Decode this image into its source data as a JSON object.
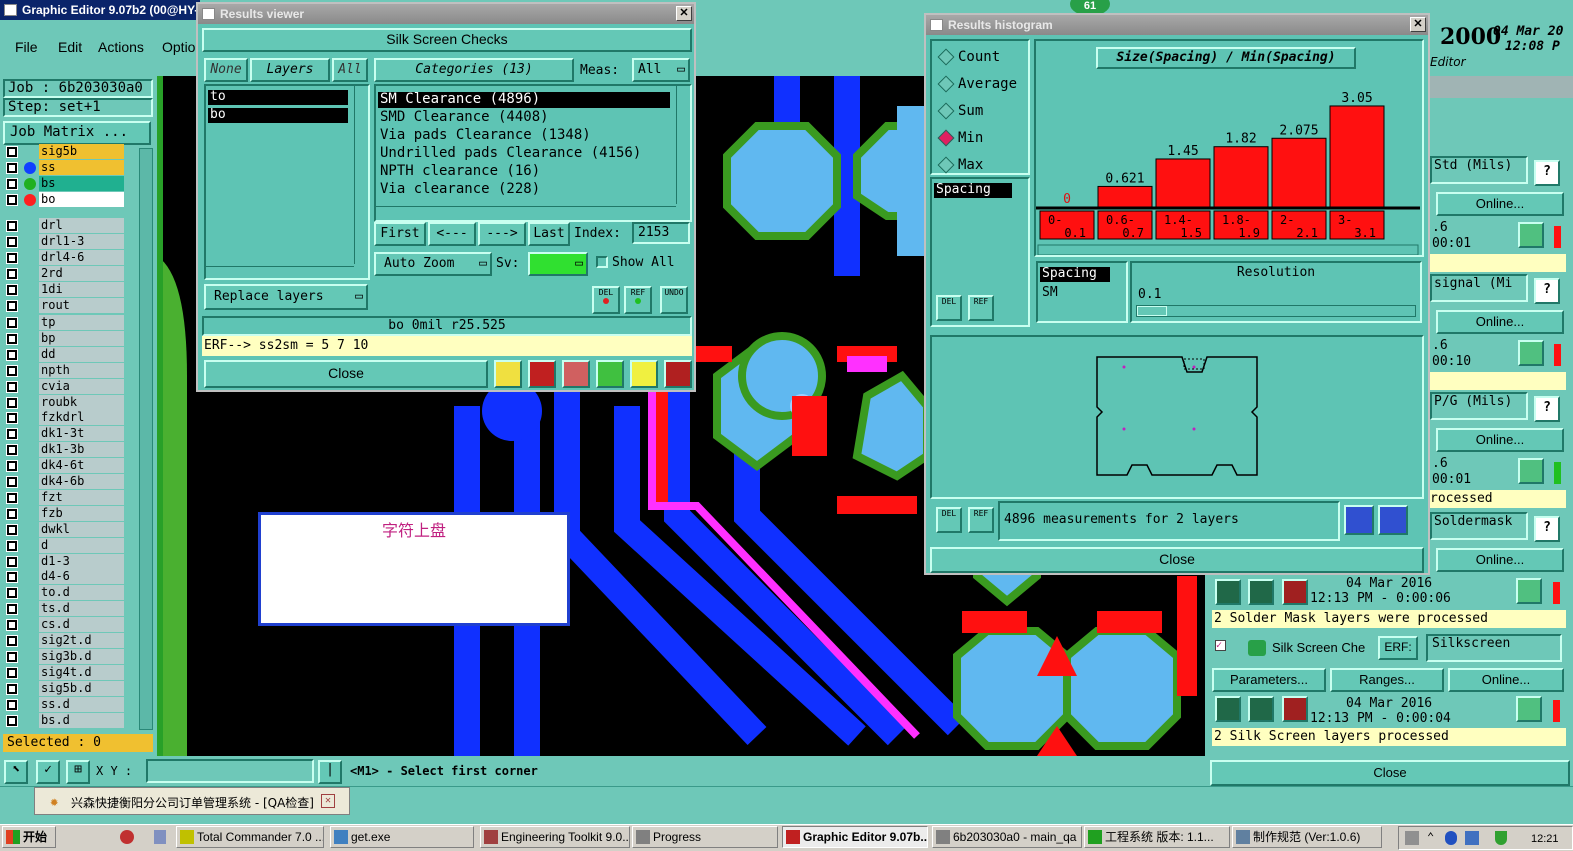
{
  "main": {
    "title": "Graphic Editor 9.07b2 (00@HY-I",
    "menu": [
      "File",
      "Edit",
      "Actions",
      "Optio"
    ],
    "job": "Job : 6b203030a0",
    "step": "Step: set+1",
    "job_matrix": "Job Matrix ...",
    "selected": "Selected : 0",
    "layers_top": [
      {
        "name": "sig5b",
        "color": "#f0c030"
      },
      {
        "name": "ss",
        "color": "#f0c030",
        "dot": "#1040ff"
      },
      {
        "name": "bs",
        "color": "#20b090",
        "dot": "#20b020"
      },
      {
        "name": "bo",
        "color": "#ffffff",
        "dot": "#ff2020"
      }
    ],
    "layers_mid": [
      "drl",
      "drl1-3",
      "drl4-6",
      "2rd",
      "1di",
      "rout"
    ],
    "layers_bottom": [
      "tp",
      "bp",
      "dd",
      "npth",
      "cvia",
      "roubk",
      "fzkdrl",
      "dk1-3t",
      "dk1-3b",
      "dk4-6t",
      "dk4-6b",
      "fzt",
      "fzb",
      "dwkl",
      "d",
      "d1-3",
      "d4-6",
      "to.d",
      "ts.d",
      "cs.d",
      "sig2t.d",
      "sig3b.d",
      "sig4t.d",
      "sig5b.d",
      "ss.d",
      "bs.d"
    ],
    "coord_label": "X Y :",
    "status_msg": "<M1> - Select first corner",
    "date_right": "04 Mar 20",
    "time_right": "12:08 P",
    "year": "2000",
    "editor_label": "Editor",
    "badge_61": "61"
  },
  "annotation_box": {
    "text": "字符上盘"
  },
  "results_viewer": {
    "title": "Results viewer",
    "header": "Silk Screen Checks",
    "none": "None",
    "layers": "Layers",
    "all": "All",
    "categories": "Categories (13)",
    "meas_label": "Meas:",
    "meas_value": "All",
    "layer_items": [
      "to",
      "bo"
    ],
    "category_items": [
      "SM Clearance (4896)",
      "SMD Clearance (4408)",
      "Via pads Clearance (1348)",
      "Undrilled pads Clearance (4156)",
      "NPTH clearance (16)",
      "Via clearance (228)"
    ],
    "first": "First",
    "prev": "<---",
    "next": "--->",
    "last": "Last",
    "index_label": "Index:",
    "index_value": "2153",
    "auto_zoom": "Auto Zoom",
    "sv_label": "Sv:",
    "show_all": "Show All",
    "replace_layers": "Replace layers",
    "del": "DEL",
    "ref": "REF",
    "undo": "UNDO",
    "status": "bo 0mil r25.525",
    "erf": "ERF--> ss2sm = 5 7 10",
    "close": "Close"
  },
  "histogram": {
    "title": "Results histogram",
    "modes": [
      "Count",
      "Average",
      "Sum",
      "Min",
      "Max"
    ],
    "selected_mode": "Min",
    "chart_title": "Size(Spacing) / Min(Spacing)",
    "spacing": "Spacing",
    "sm": "SM",
    "resolution_label": "Resolution",
    "resolution_value": "0.1",
    "measurements": "4896 measurements for 2 layers",
    "close": "Close",
    "del": "DEL",
    "ref": "REF"
  },
  "chart_data": {
    "type": "bar",
    "title": "Size(Spacing) / Min(Spacing)",
    "categories": [
      "0-0.1",
      "0.6-0.7",
      "1.4-1.5",
      "1.8-1.9",
      "2-2.1",
      "3-3.1"
    ],
    "values": [
      0,
      0.621,
      1.45,
      1.82,
      2.075,
      3.05
    ],
    "value_labels": [
      "0",
      "0.621",
      "1.45",
      "1.82",
      "2.075",
      "3.05"
    ],
    "ylim": [
      0,
      3.2
    ],
    "bar_color": "#ff1010"
  },
  "right_panel": {
    "rows": [
      {
        "label": "Std (Mils)",
        "online": "Online...",
        "num": ".6",
        "time": "00:01"
      },
      {
        "label": "signal (Mi",
        "online": "Online...",
        "num": ".6",
        "time": "00:10"
      },
      {
        "label": "P/G (Mils)",
        "online": "Online...",
        "num": ".6",
        "time": "00:01",
        "msg": "rocessed"
      },
      {
        "label": "Soldermask",
        "online": "Online..."
      }
    ],
    "sm_date": "04 Mar 2016",
    "sm_time": "12:13 PM - 0:00:06",
    "sm_msg": "2 Solder Mask layers were processed",
    "ss_name": "Silk Screen Che",
    "ss_erf": "ERF:",
    "ss_erf_value": "Silkscreen",
    "parameters": "Parameters...",
    "ranges": "Ranges...",
    "online": "Online...",
    "ss_date": "04 Mar 2016",
    "ss_time": "12:13 PM - 0:00:04",
    "ss_msg": "2 Silk Screen layers processed",
    "close": "Close"
  },
  "popup": {
    "text": "兴森快捷衡阳分公司订单管理系统 - [QA检查]"
  },
  "taskbar": {
    "start": "开始",
    "items": [
      "Total Commander 7.0 ...",
      "get.exe",
      "Engineering Toolkit 9.0...",
      "Progress",
      "Graphic Editor 9.07b...",
      "6b203030a0 - main_qa",
      "工程系统  版本: 1.1...",
      "制作规范 (Ver:1.0.6)"
    ],
    "active": "Graphic Editor 9.07b...",
    "clock": "12:21"
  }
}
